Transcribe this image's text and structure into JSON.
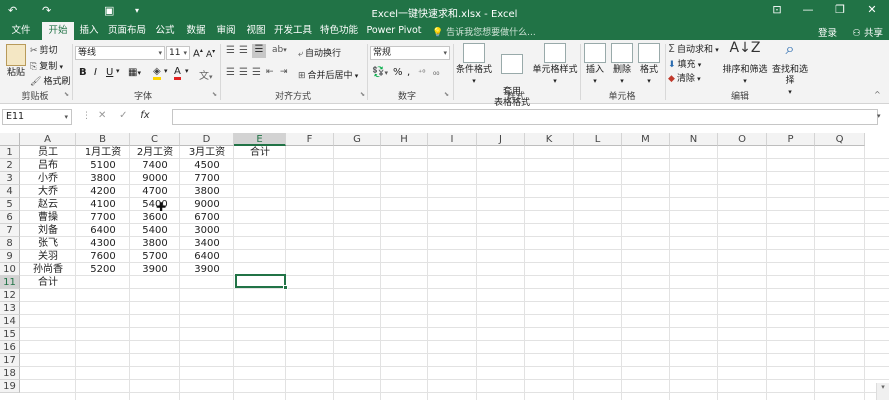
{
  "titlebar": {
    "title": "Excel一键快速求和.xlsx - Excel",
    "undo_icon": "undo-icon",
    "redo_icon": "redo-icon",
    "save_icon": "save-icon"
  },
  "tabs": [
    "文件",
    "开始",
    "插入",
    "页面布局",
    "公式",
    "数据",
    "审阅",
    "视图",
    "开发工具",
    "特色功能",
    "Power Pivot"
  ],
  "active_tab": "开始",
  "tell_me": "告诉我您想要做什么...",
  "login": "登录",
  "share": "共享",
  "ribbon": {
    "clipboard": {
      "label": "剪贴板",
      "paste": "粘贴",
      "cut": "剪切",
      "copy": "复制",
      "format_painter": "格式刷"
    },
    "font": {
      "label": "字体",
      "font_name": "等线",
      "font_size": "11",
      "bold": "B",
      "italic": "I",
      "underline": "U"
    },
    "alignment": {
      "label": "对齐方式",
      "wrap": "自动换行",
      "merge": "合并后居中"
    },
    "number": {
      "label": "数字",
      "format": "常规"
    },
    "styles": {
      "label": "样式",
      "cond": "条件格式",
      "table": "套用\n表格格式",
      "cell_styles": "单元格样式"
    },
    "cells": {
      "label": "单元格",
      "insert": "插入",
      "delete": "删除",
      "format": "格式"
    },
    "editing": {
      "label": "编辑",
      "autosum": "自动求和",
      "fill": "填充",
      "clear": "清除",
      "sort": "排序和筛选",
      "find": "查找和选择"
    }
  },
  "formula_bar": {
    "name_box": "E11",
    "formula": ""
  },
  "columns": [
    "A",
    "B",
    "C",
    "D",
    "E",
    "F",
    "G",
    "H",
    "I",
    "J",
    "K",
    "L",
    "M",
    "N",
    "O",
    "P",
    "Q"
  ],
  "selected_column": "E",
  "selected_row": "11",
  "rows": [
    "1",
    "2",
    "3",
    "4",
    "5",
    "6",
    "7",
    "8",
    "9",
    "10",
    "11",
    "12",
    "13",
    "14",
    "15",
    "16",
    "17",
    "18",
    "19"
  ],
  "sheet": [
    [
      "员工",
      "1月工资",
      "2月工资",
      "3月工资",
      "合计"
    ],
    [
      "吕布",
      "5100",
      "7400",
      "4500",
      ""
    ],
    [
      "小乔",
      "3800",
      "9000",
      "7700",
      ""
    ],
    [
      "大乔",
      "4200",
      "4700",
      "3800",
      ""
    ],
    [
      "赵云",
      "4100",
      "5400",
      "9000",
      ""
    ],
    [
      "曹操",
      "7700",
      "3600",
      "6700",
      ""
    ],
    [
      "刘备",
      "6400",
      "5400",
      "3000",
      ""
    ],
    [
      "张飞",
      "4300",
      "3800",
      "3400",
      ""
    ],
    [
      "关羽",
      "7600",
      "5700",
      "6400",
      ""
    ],
    [
      "孙尚香",
      "5200",
      "3900",
      "3900",
      ""
    ],
    [
      "合计",
      "",
      "",
      "",
      ""
    ]
  ]
}
